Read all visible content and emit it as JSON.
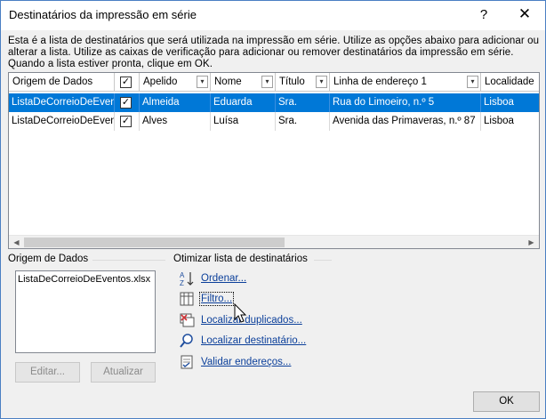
{
  "window": {
    "title": "Destinatários da impressão em série",
    "help_label": "?",
    "close_label": "✕"
  },
  "description": "Esta é a lista de destinatários que será utilizada na impressão em série. Utilize as opções abaixo para adicionar ou alterar a lista. Utilize as caixas de verificação para adicionar ou remover destinatários da impressão em série. Quando a lista estiver pronta, clique em OK.",
  "grid": {
    "columns": [
      "Origem de Dados",
      "",
      "Apelido",
      "Nome",
      "Título",
      "Linha de endereço 1",
      "Localidade"
    ],
    "header_checkbox": "✓",
    "rows": [
      {
        "source": "ListaDeCorreioDeEventos.xlsx",
        "checked": "✓",
        "apelido": "Almeida",
        "nome": "Eduarda",
        "titulo": "Sra.",
        "endereco": "Rua do Limoeiro, n.º 5",
        "localidade": "Lisboa",
        "selected": true
      },
      {
        "source": "ListaDeCorreioDeEventos.xlsx",
        "checked": "✓",
        "apelido": "Alves",
        "nome": "Luísa",
        "titulo": "Sra.",
        "endereco": "Avenida das Primaveras, n.º 87",
        "localidade": "Lisboa",
        "selected": false
      }
    ],
    "scroll_left": "◀",
    "scroll_right": "▶",
    "dropdown_glyph": "▾"
  },
  "data_source": {
    "label": "Origem de Dados",
    "items": [
      "ListaDeCorreioDeEventos.xlsx"
    ],
    "edit_label": "Editar...",
    "refresh_label": "Atualizar"
  },
  "refine": {
    "label": "Otimizar lista de destinatários",
    "links": [
      {
        "label": "Ordenar...",
        "icon": "sort-az-icon"
      },
      {
        "label": "Filtro...",
        "icon": "filter-icon"
      },
      {
        "label": "Localizar duplicados...",
        "icon": "find-duplicates-icon"
      },
      {
        "label": "Localizar destinatário...",
        "icon": "find-recipient-icon"
      },
      {
        "label": "Validar endereços...",
        "icon": "validate-addresses-icon"
      }
    ]
  },
  "ok_label": "OK",
  "colors": {
    "accent": "#0078d7",
    "link": "#0b3f9a",
    "dialog_bg": "#f0f0f0"
  }
}
